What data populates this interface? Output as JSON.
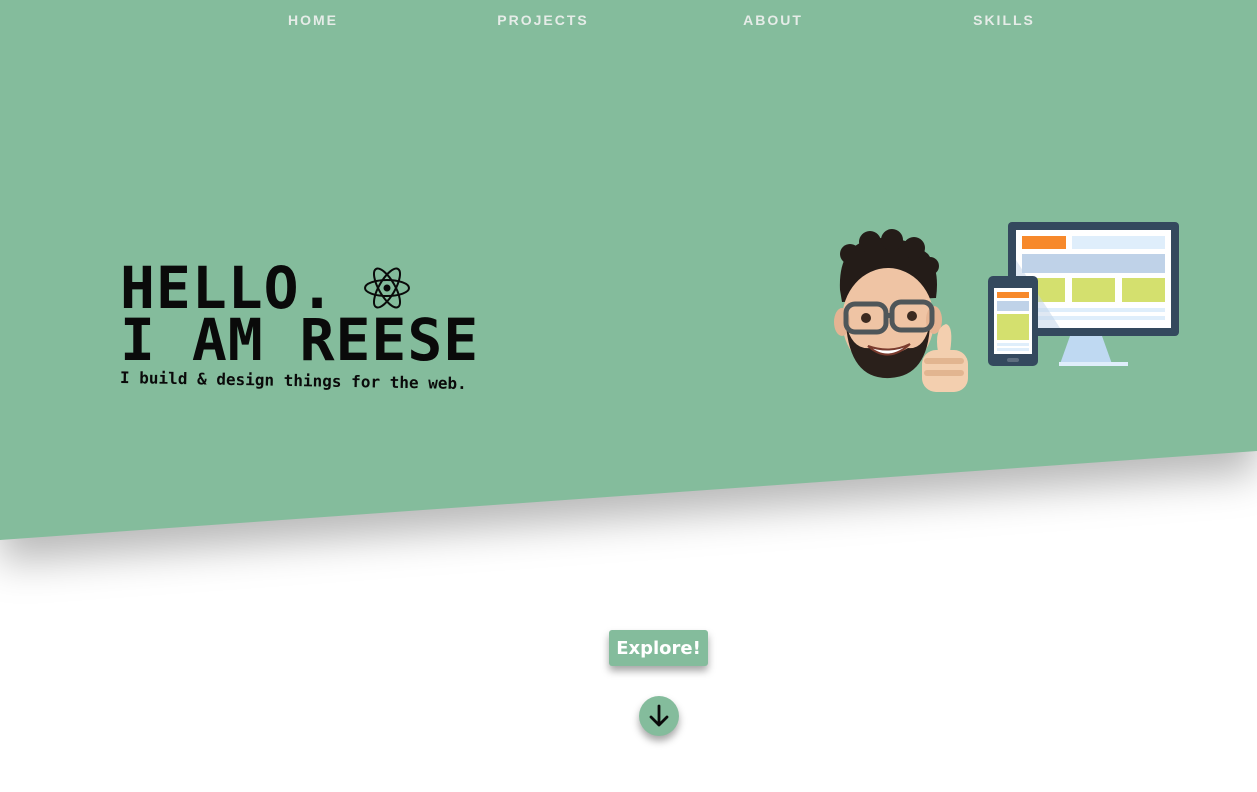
{
  "nav": {
    "items": [
      {
        "label": "HOME"
      },
      {
        "label": "PROJECTS"
      },
      {
        "label": "ABOUT"
      },
      {
        "label": "SKILLS"
      }
    ]
  },
  "hero": {
    "greeting": "HELLO.",
    "name_line": "I AM REESE",
    "tagline": "I build & design things for the web.",
    "icon": "atom-icon",
    "illustration": "memoji-thumbs-up-with-responsive-devices"
  },
  "cta": {
    "explore_label": "Explore!",
    "scroll_icon": "arrow-down-icon"
  },
  "colors": {
    "accent": "#84bc9c",
    "text": "#0a0a0a",
    "nav_text": "#e6ece8",
    "background": "#ffffff"
  }
}
